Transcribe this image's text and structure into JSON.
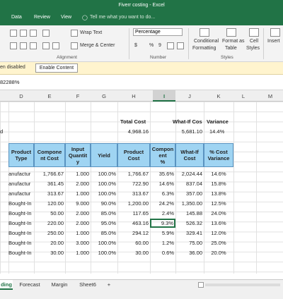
{
  "titlebar": {
    "title": "Fiverr costing - Excel"
  },
  "ribbon_tabs": [
    "Data",
    "Review",
    "View"
  ],
  "tell_me": {
    "placeholder": "Tell me what you want to do..."
  },
  "ribbon": {
    "wrap_text": "Wrap Text",
    "merge_center": "Merge & Center",
    "alignment_label": "Alignment",
    "number_format": "Percentage",
    "number_symbols": [
      "$",
      "%",
      "9"
    ],
    "number_label": "Number",
    "conditional_formatting": [
      "Conditional",
      "Formatting"
    ],
    "format_as_table": [
      "Format as",
      "Table"
    ],
    "cell_styles": [
      "Cell",
      "Styles"
    ],
    "styles_label": "Styles",
    "insert": "Insert"
  },
  "message_bar": {
    "text": "en disabled",
    "button": "Enable Content"
  },
  "formula_bar": {
    "content": "82288%"
  },
  "columns": [
    "D",
    "E",
    "F",
    "G",
    "H",
    "I",
    "J",
    "K",
    "L",
    "M"
  ],
  "selected_column": "I",
  "summary": {
    "total_cost_label": "Total Cost",
    "total_cost_value": "4,968.16",
    "whatif_label": "What-If Cos",
    "whatif_value": "5,681.10",
    "variance_label": "Variance",
    "variance_value": "14.4%",
    "row_stub": "d"
  },
  "table": {
    "headers": [
      [
        "Product",
        "Type"
      ],
      [
        "Compone",
        "nt Cost"
      ],
      [
        "Input",
        "Quantit",
        "y"
      ],
      [
        "Yield"
      ],
      [
        "Product",
        "Cost"
      ],
      [
        "Compon",
        "ent",
        "%"
      ],
      [
        "What-If",
        "Cost"
      ],
      [
        "% Cost",
        "Variance"
      ]
    ],
    "rows": [
      [
        "anufactur",
        "1,766.67",
        "1.000",
        "100.0%",
        "1,766.67",
        "35.6%",
        "2,024.44",
        "14.6%"
      ],
      [
        "anufactur",
        "361.45",
        "2.000",
        "100.0%",
        "722.90",
        "14.6%",
        "837.04",
        "15.8%"
      ],
      [
        "anufactur",
        "313.67",
        "1.000",
        "100.0%",
        "313.67",
        "6.3%",
        "357.00",
        "13.8%"
      ],
      [
        "Bought-In",
        "120.00",
        "9.000",
        "90.0%",
        "1,200.00",
        "24.2%",
        "1,350.00",
        "12.5%"
      ],
      [
        "Bought-In",
        "50.00",
        "2.000",
        "85.0%",
        "117.65",
        "2.4%",
        "145.88",
        "24.0%"
      ],
      [
        "Bought-In",
        "220.00",
        "2.000",
        "95.0%",
        "463.16",
        "9.3%",
        "526.32",
        "13.6%"
      ],
      [
        "Bought-In",
        "250.00",
        "1.000",
        "85.0%",
        "294.12",
        "5.9%",
        "329.41",
        "12.0%"
      ],
      [
        "Bought-In",
        "20.00",
        "3.000",
        "100.0%",
        "60.00",
        "1.2%",
        "75.00",
        "25.0%"
      ],
      [
        "Bought-In",
        "30.00",
        "1.000",
        "100.0%",
        "30.00",
        "0.6%",
        "36.00",
        "20.0%"
      ]
    ]
  },
  "sheet_tabs": [
    "ding",
    "Forecast",
    "Margin",
    "Sheet6"
  ],
  "active_sheet": "ding",
  "add_sheet": "+",
  "colors": {
    "excel_green": "#217346",
    "header_fill": "#9fd4f2",
    "msgbar": "#fff4ce"
  }
}
